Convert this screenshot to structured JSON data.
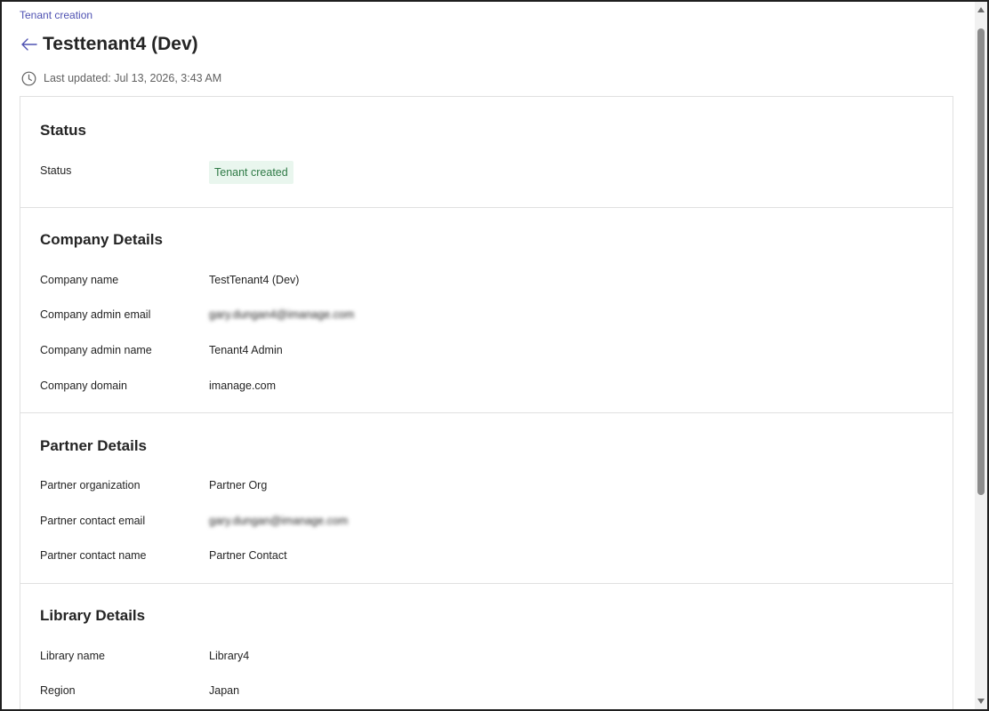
{
  "breadcrumb": "Tenant creation",
  "title": "Testtenant4 (Dev)",
  "last_updated": "Last updated: Jul 13, 2026, 3:43 AM",
  "status_section": {
    "heading": "Status",
    "label": "Status",
    "value": "Tenant created"
  },
  "company": {
    "heading": "Company Details",
    "rows": [
      {
        "label": "Company name",
        "value": "TestTenant4 (Dev)"
      },
      {
        "label": "Company admin email",
        "value": "gary.dungan4@imanage.com"
      },
      {
        "label": "Company admin name",
        "value": "Tenant4 Admin"
      },
      {
        "label": "Company domain",
        "value": "imanage.com"
      }
    ]
  },
  "partner": {
    "heading": "Partner Details",
    "rows": [
      {
        "label": "Partner organization",
        "value": "Partner Org"
      },
      {
        "label": "Partner contact email",
        "value": "gary.dungan@imanage.com"
      },
      {
        "label": "Partner contact name",
        "value": "Partner Contact"
      }
    ]
  },
  "library": {
    "heading": "Library Details",
    "rows": [
      {
        "label": "Library name",
        "value": "Library4"
      },
      {
        "label": "Region",
        "value": "Japan"
      }
    ]
  },
  "colors": {
    "accent": "#4f52b2",
    "badge_bg": "#e9f6ee",
    "badge_text": "#2f7a46"
  }
}
